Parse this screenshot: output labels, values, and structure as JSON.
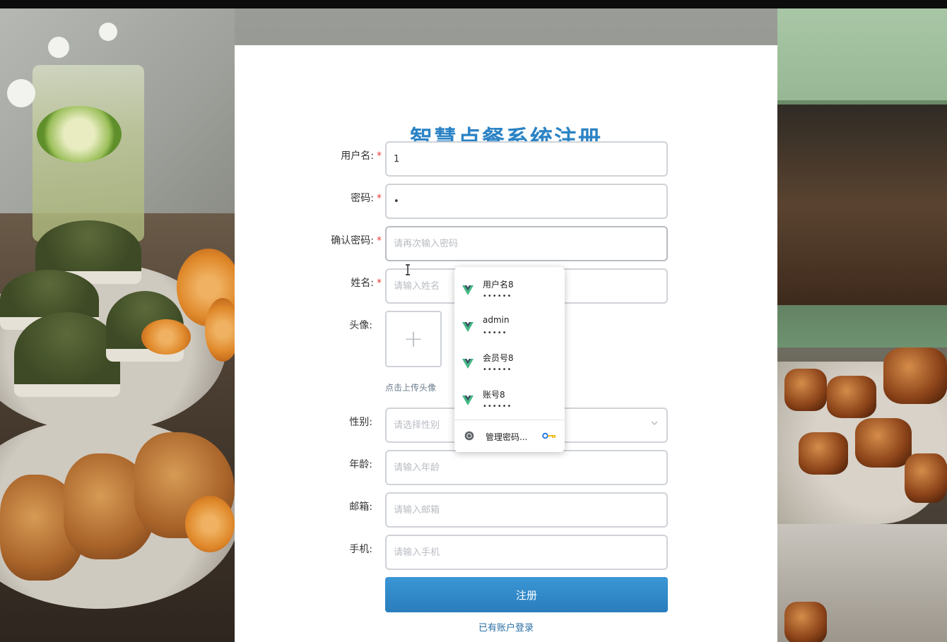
{
  "page": {
    "title": "智慧点餐系统注册"
  },
  "form": {
    "username": {
      "label": "用户名:",
      "value": "1",
      "required": true
    },
    "password": {
      "label": "密码:",
      "value": "•",
      "required": true
    },
    "confirm_password": {
      "label": "确认密码:",
      "placeholder": "请再次输入密码",
      "required": true
    },
    "name": {
      "label": "姓名:",
      "placeholder": "请输入姓名",
      "required": true
    },
    "avatar": {
      "label": "头像:",
      "hint": "点击上传头像"
    },
    "gender": {
      "label": "性别:",
      "placeholder": "请选择性别"
    },
    "age": {
      "label": "年龄:",
      "placeholder": "请输入年龄"
    },
    "email": {
      "label": "邮箱:",
      "placeholder": "请输入邮箱"
    },
    "phone": {
      "label": "手机:",
      "placeholder": "请输入手机"
    },
    "required_mark": "*",
    "submit_label": "注册",
    "login_link": "已有账户登录"
  },
  "autocomplete": {
    "items": [
      {
        "user": "用户名8",
        "pass": "••••••"
      },
      {
        "user": "admin",
        "pass": "•••••"
      },
      {
        "user": "会员号8",
        "pass": "••••••"
      },
      {
        "user": "账号8",
        "pass": "••••••"
      }
    ],
    "manage_label": "管理密码..."
  },
  "colors": {
    "accent": "#2b83c5",
    "button": "#2a7dbd",
    "required": "#e53935",
    "vue_green": "#41b883",
    "vue_dark": "#35495e"
  }
}
